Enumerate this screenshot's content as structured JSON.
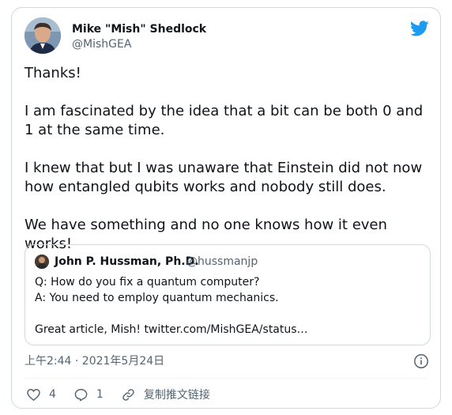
{
  "author": {
    "name": "Mike \"Mish\" Shedlock",
    "handle": "@MishGEA"
  },
  "tweet": {
    "paragraphs": [
      "Thanks!",
      "I am fascinated by the idea that a bit can be both 0 and 1 at the same time.",
      "I knew that but I was unaware that Einstein did not now how entangled qubits works and nobody still does.",
      "We have something and no one knows how it even works!"
    ]
  },
  "quoted_tweet": {
    "name": "John P. Hussman, Ph.D.",
    "handle": "@hussmanjp",
    "lines": [
      "Q: How do you fix a quantum computer?",
      "A: You need to employ quantum mechanics.",
      "",
      "Great article, Mish! twitter.com/MishGEA/status…"
    ]
  },
  "timestamp": "上午2:44 · 2021年5月24日",
  "actions": {
    "likes": "4",
    "replies": "1",
    "copy_link": "复制推文链接"
  },
  "colors": {
    "twitter_blue": "#1d9bf0",
    "secondary_text": "#536471",
    "border": "#cfd9de"
  },
  "icons": [
    "twitter-bird-icon",
    "info-icon",
    "heart-icon",
    "reply-icon",
    "link-icon"
  ]
}
